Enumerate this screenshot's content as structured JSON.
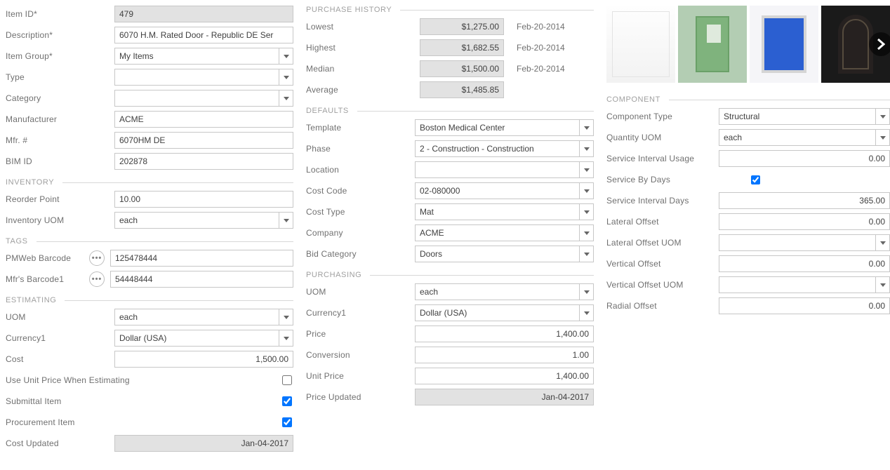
{
  "labels": {
    "item_id": "Item ID*",
    "description": "Description*",
    "item_group": "Item Group*",
    "type": "Type",
    "category": "Category",
    "manufacturer": "Manufacturer",
    "mfr_no": "Mfr. #",
    "bim_id": "BIM ID",
    "reorder_point": "Reorder Point",
    "inventory_uom": "Inventory UOM",
    "pmweb_barcode": "PMWeb Barcode",
    "mfr_barcode1": "Mfr's Barcode1",
    "uom": "UOM",
    "currency1": "Currency1",
    "cost": "Cost",
    "use_unit_price": "Use Unit Price When Estimating",
    "submittal_item": "Submittal Item",
    "procurement_item": "Procurement Item",
    "cost_updated": "Cost Updated",
    "lowest": "Lowest",
    "highest": "Highest",
    "median": "Median",
    "average": "Average",
    "template": "Template",
    "phase": "Phase",
    "location": "Location",
    "cost_code": "Cost Code",
    "cost_type": "Cost Type",
    "company": "Company",
    "bid_category": "Bid Category",
    "price": "Price",
    "conversion": "Conversion",
    "unit_price": "Unit Price",
    "price_updated": "Price Updated",
    "component_type": "Component Type",
    "quantity_uom": "Quantity UOM",
    "service_interval_usage": "Service Interval Usage",
    "service_by_days": "Service By Days",
    "service_interval_days": "Service Interval Days",
    "lateral_offset": "Lateral Offset",
    "lateral_offset_uom": "Lateral Offset UOM",
    "vertical_offset": "Vertical Offset",
    "vertical_offset_uom": "Vertical Offset UOM",
    "radial_offset": "Radial Offset"
  },
  "sections": {
    "inventory": "INVENTORY",
    "tags": "TAGS",
    "estimating": "ESTIMATING",
    "purchase_history": "PURCHASE HISTORY",
    "defaults": "DEFAULTS",
    "purchasing": "PURCHASING",
    "component": "COMPONENT"
  },
  "item": {
    "id": "479",
    "description": "6070 H.M. Rated Door - Republic DE Ser",
    "item_group": "My Items",
    "type": "",
    "category": "",
    "manufacturer": "ACME",
    "mfr_no": "6070HM DE",
    "bim_id": "202878"
  },
  "inventory": {
    "reorder_point": "10.00",
    "uom": "each"
  },
  "tags": {
    "pmweb_barcode": "125478444",
    "mfr_barcode1": "54448444"
  },
  "estimating": {
    "uom": "each",
    "currency1": "Dollar (USA)",
    "cost": "1,500.00",
    "use_unit_price": false,
    "submittal_item": true,
    "procurement_item": true,
    "cost_updated": "Jan-04-2017"
  },
  "purchase_history": {
    "lowest": {
      "value": "$1,275.00",
      "date": "Feb-20-2014"
    },
    "highest": {
      "value": "$1,682.55",
      "date": "Feb-20-2014"
    },
    "median": {
      "value": "$1,500.00",
      "date": "Feb-20-2014"
    },
    "average": {
      "value": "$1,485.85"
    }
  },
  "defaults": {
    "template": "Boston Medical Center",
    "phase": "2 - Construction - Construction",
    "location": "",
    "cost_code": "02-080000",
    "cost_type": "Mat",
    "company": "ACME",
    "bid_category": "Doors"
  },
  "purchasing": {
    "uom": "each",
    "currency1": "Dollar (USA)",
    "price": "1,400.00",
    "conversion": "1.00",
    "unit_price": "1,400.00",
    "price_updated": "Jan-04-2017"
  },
  "component": {
    "type": "Structural",
    "quantity_uom": "each",
    "service_interval_usage": "0.00",
    "service_by_days": true,
    "service_interval_days": "365.00",
    "lateral_offset": "0.00",
    "lateral_offset_uom": "",
    "vertical_offset": "0.00",
    "vertical_offset_uom": "",
    "radial_offset": "0.00"
  }
}
